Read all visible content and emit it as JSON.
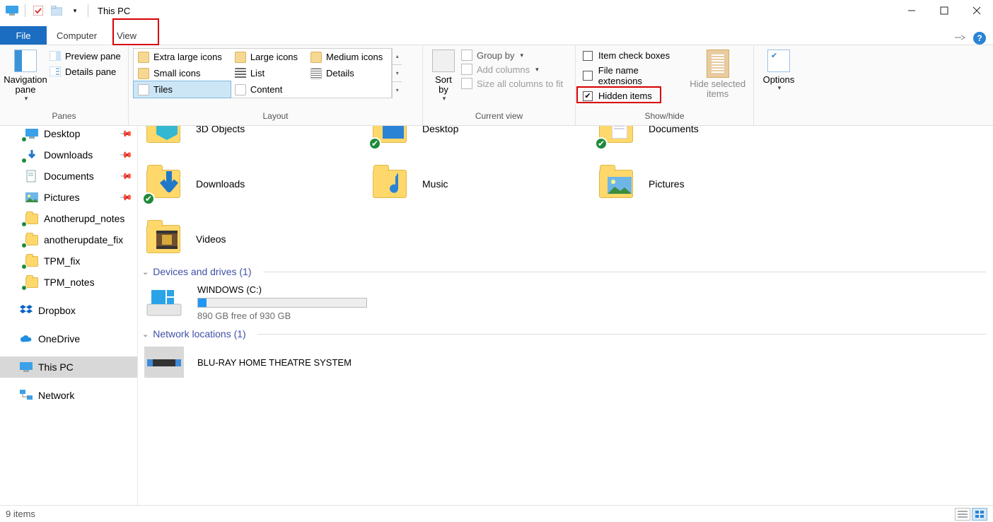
{
  "window": {
    "title": "This PC"
  },
  "tabs": {
    "file": "File",
    "computer": "Computer",
    "view": "View"
  },
  "ribbon": {
    "panes": {
      "navigation_pane": "Navigation\npane",
      "preview_pane": "Preview pane",
      "details_pane": "Details pane",
      "group_label": "Panes"
    },
    "layout": {
      "xl": "Extra large icons",
      "large": "Large icons",
      "medium": "Medium icons",
      "small": "Small icons",
      "list": "List",
      "details": "Details",
      "tiles": "Tiles",
      "content": "Content",
      "group_label": "Layout"
    },
    "currentview": {
      "sort_by": "Sort\nby",
      "group_by": "Group by",
      "add_columns": "Add columns",
      "size_all": "Size all columns to fit",
      "group_label": "Current view"
    },
    "showhide": {
      "item_check_boxes": "Item check boxes",
      "file_name_ext": "File name extensions",
      "hidden_items": "Hidden items",
      "hide_selected": "Hide selected\nitems",
      "group_label": "Show/hide"
    },
    "options": {
      "label": "Options"
    }
  },
  "nav": {
    "items": [
      {
        "label": "Desktop",
        "icon": "desktop",
        "pinned": true,
        "sync": true
      },
      {
        "label": "Downloads",
        "icon": "downloads",
        "pinned": true,
        "sync": true
      },
      {
        "label": "Documents",
        "icon": "documents",
        "pinned": true,
        "sync": false
      },
      {
        "label": "Pictures",
        "icon": "pictures",
        "pinned": true,
        "sync": false
      },
      {
        "label": "Anotherupd_notes",
        "icon": "folder",
        "pinned": false,
        "sync": true
      },
      {
        "label": "anotherupdate_fix",
        "icon": "folder",
        "pinned": false,
        "sync": true
      },
      {
        "label": "TPM_fix",
        "icon": "folder",
        "pinned": false,
        "sync": true
      },
      {
        "label": "TPM_notes",
        "icon": "folder",
        "pinned": false,
        "sync": true
      }
    ],
    "roots": [
      {
        "label": "Dropbox",
        "icon": "dropbox"
      },
      {
        "label": "OneDrive",
        "icon": "onedrive"
      },
      {
        "label": "This PC",
        "icon": "thispc",
        "selected": true
      },
      {
        "label": "Network",
        "icon": "network"
      }
    ]
  },
  "content": {
    "row1": [
      {
        "label": "3D Objects",
        "kind": "3d",
        "sync": false
      },
      {
        "label": "Desktop",
        "kind": "desktop",
        "sync": true
      },
      {
        "label": "Documents",
        "kind": "documents",
        "sync": true
      }
    ],
    "row2": [
      {
        "label": "Downloads",
        "kind": "downloads",
        "sync": true
      },
      {
        "label": "Music",
        "kind": "music",
        "sync": false
      },
      {
        "label": "Pictures",
        "kind": "pictures",
        "sync": false
      }
    ],
    "row3": [
      {
        "label": "Videos",
        "kind": "videos",
        "sync": false
      }
    ],
    "devices_head": "Devices and drives (1)",
    "drive": {
      "name": "WINDOWS (C:)",
      "free_text": "890 GB free of 930 GB",
      "fill_pct": 5
    },
    "netloc_head": "Network locations (1)",
    "netloc_item": "BLU-RAY HOME THEATRE SYSTEM"
  },
  "status": {
    "text": "9 items"
  }
}
